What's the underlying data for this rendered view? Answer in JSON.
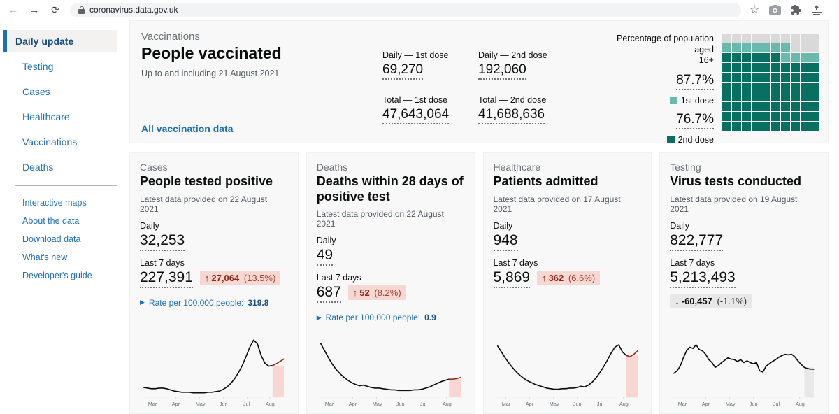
{
  "browser": {
    "url": "coronavirus.data.gov.uk",
    "back_icon": "←",
    "forward_icon": "→",
    "reload_icon": "⟳",
    "bookmark_star_icon": "☆"
  },
  "sidebar": {
    "primary": [
      {
        "label": "Daily update",
        "active": true
      },
      {
        "label": "Testing",
        "active": false
      },
      {
        "label": "Cases",
        "active": false
      },
      {
        "label": "Healthcare",
        "active": false
      },
      {
        "label": "Vaccinations",
        "active": false
      },
      {
        "label": "Deaths",
        "active": false
      }
    ],
    "secondary": [
      {
        "label": "Interactive maps"
      },
      {
        "label": "About the data"
      },
      {
        "label": "Download data"
      },
      {
        "label": "What's new"
      },
      {
        "label": "Developer's guide"
      }
    ]
  },
  "hero": {
    "caption": "Vaccinations",
    "title": "People vaccinated",
    "subtitle": "Up to and including 21 August 2021",
    "link_label": "All vaccination data",
    "metrics": [
      {
        "label": "Daily — 1st dose",
        "value": "69,270"
      },
      {
        "label": "Daily — 2nd dose",
        "value": "192,060"
      },
      {
        "label": "Total — 1st dose",
        "value": "47,643,064"
      },
      {
        "label": "Total — 2nd dose",
        "value": "41,688,636"
      }
    ],
    "waffle": {
      "title_line1": "Percentage of population aged",
      "title_line2": "16+",
      "first_dose_pct_label": "87.7%",
      "first_dose_pct": 87.7,
      "first_dose_legend": "1st dose",
      "second_dose_pct_label": "76.7%",
      "second_dose_pct": 76.7,
      "second_dose_legend": "2nd dose",
      "colors": {
        "first_dose": "#69b9af",
        "second_dose": "#087060",
        "empty": "#d9d9d9"
      }
    }
  },
  "cards": [
    {
      "caption": "Cases",
      "title": "People tested positive",
      "date": "Latest data provided on 22 August 2021",
      "daily_label": "Daily",
      "daily_value": "32,253",
      "week_label": "Last 7 days",
      "week_value": "227,391",
      "change": {
        "arrow": "↑",
        "value": "27,064",
        "pct": "(13.5%)",
        "style": "bad",
        "below": false
      },
      "rate": {
        "label": "Rate per 100,000 people:",
        "value": "319.8"
      },
      "chart_data": {
        "type": "line",
        "x_labels": [
          "Mar",
          "Apr",
          "May",
          "Jun",
          "Jul",
          "Aug"
        ],
        "values": [
          16,
          15,
          14,
          14,
          15,
          15,
          14,
          12,
          10,
          9,
          8,
          8,
          8,
          7,
          7,
          7,
          7,
          8,
          8,
          9,
          10,
          13,
          17,
          23,
          31,
          41,
          53,
          68,
          84,
          96,
          90,
          70,
          57,
          52,
          53,
          56,
          60,
          64
        ],
        "red_tail_points": 4,
        "band_color": "#f6d7d2"
      }
    },
    {
      "caption": "Deaths",
      "title": "Deaths within 28 days of positive test",
      "date": "Latest data provided on 22 August 2021",
      "daily_label": "Daily",
      "daily_value": "49",
      "week_label": "Last 7 days",
      "week_value": "687",
      "change": {
        "arrow": "↑",
        "value": "52",
        "pct": "(8.2%)",
        "style": "bad",
        "below": false
      },
      "rate": {
        "label": "Rate per 100,000 people:",
        "value": "0.9"
      },
      "chart_data": {
        "type": "line",
        "x_labels": [
          "Mar",
          "Apr",
          "May",
          "Jun",
          "Jul",
          "Aug"
        ],
        "values": [
          90,
          78,
          66,
          55,
          46,
          39,
          33,
          28,
          24,
          21,
          19,
          20,
          18,
          16,
          15,
          15,
          14,
          13,
          12,
          12,
          11,
          11,
          11,
          11,
          12,
          12,
          13,
          15,
          17,
          20,
          23,
          26,
          28,
          30,
          30,
          31,
          33
        ],
        "red_tail_points": 4,
        "band_color": "#f6d7d2"
      }
    },
    {
      "caption": "Healthcare",
      "title": "Patients admitted",
      "date": "Latest data provided on 17 August 2021",
      "daily_label": "Daily",
      "daily_value": "948",
      "week_label": "Last 7 days",
      "week_value": "5,869",
      "change": {
        "arrow": "↑",
        "value": "362",
        "pct": "(6.6%)",
        "style": "bad",
        "below": false
      },
      "rate": null,
      "chart_data": {
        "type": "line",
        "x_labels": [
          "Mar",
          "Apr",
          "May",
          "Jun",
          "Jul",
          "Aug"
        ],
        "values": [
          86,
          76,
          66,
          57,
          49,
          42,
          36,
          31,
          27,
          24,
          21,
          19,
          17,
          15,
          14,
          13,
          13,
          14,
          14,
          15,
          15,
          16,
          18,
          17,
          20,
          25,
          32,
          41,
          51,
          62,
          74,
          84,
          88,
          76,
          70,
          68,
          72,
          78
        ],
        "red_tail_points": 4,
        "band_color": "#f6d7d2"
      }
    },
    {
      "caption": "Testing",
      "title": "Virus tests conducted",
      "date": "Latest data provided on 19 August 2021",
      "daily_label": "Daily",
      "daily_value": "822,777",
      "week_label": "Last 7 days",
      "week_value": "5,213,493",
      "change": {
        "arrow": "↓",
        "value": "-60,457",
        "pct": "(-1.1%)",
        "style": "neutral",
        "below": true
      },
      "rate": null,
      "chart_data": {
        "type": "line",
        "x_labels": [
          "Mar",
          "Apr",
          "May",
          "Jun",
          "Jul",
          "Aug"
        ],
        "values": [
          40,
          44,
          52,
          66,
          78,
          84,
          82,
          88,
          80,
          78,
          72,
          63,
          58,
          50,
          53,
          58,
          62,
          66,
          64,
          63,
          60,
          63,
          58,
          61,
          58,
          56,
          58,
          44,
          42,
          52,
          56,
          60,
          63,
          67,
          70,
          72,
          71,
          72,
          68,
          61,
          55,
          50,
          48,
          47,
          47
        ],
        "red_tail_points": 0,
        "band_color": "#e8e8e8"
      }
    }
  ],
  "chart_style": {
    "line_color": "#0b0c0c",
    "red_tail_color": "#9c2c19",
    "axis_color": "#d8d8d8",
    "label_color": "#6b7276"
  }
}
